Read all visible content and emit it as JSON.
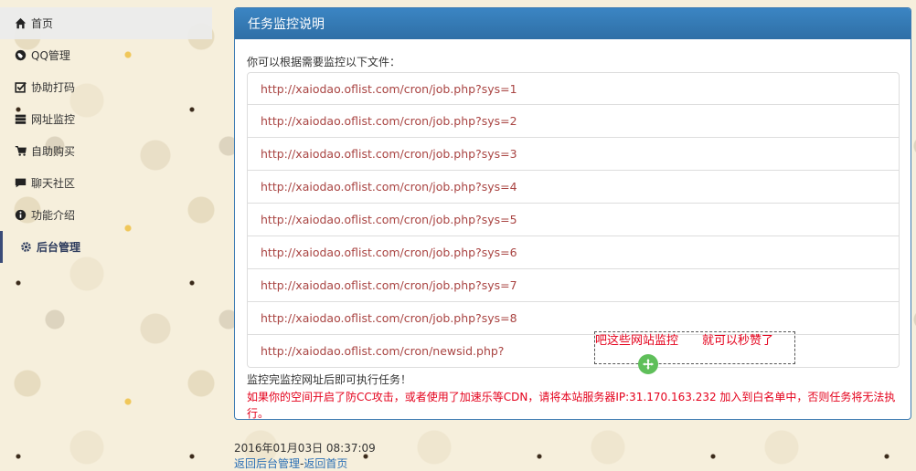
{
  "sidebar": {
    "items": [
      {
        "label": "首页",
        "icon": "home-icon"
      },
      {
        "label": "QQ管理",
        "icon": "globe-icon"
      },
      {
        "label": "协助打码",
        "icon": "check-square-icon"
      },
      {
        "label": "网址监控",
        "icon": "server-icon"
      },
      {
        "label": "自助购买",
        "icon": "cart-icon"
      },
      {
        "label": "聊天社区",
        "icon": "comment-icon"
      },
      {
        "label": "功能介绍",
        "icon": "info-circle-icon"
      },
      {
        "label": "后台管理",
        "icon": "cog-icon"
      }
    ]
  },
  "panel": {
    "title": "任务监控说明",
    "intro": "你可以根据需要监控以下文件：",
    "urls": [
      "http://xaiodao.oflist.com/cron/job.php?sys=1",
      "http://xaiodao.oflist.com/cron/job.php?sys=2",
      "http://xaiodao.oflist.com/cron/job.php?sys=3",
      "http://xaiodao.oflist.com/cron/job.php?sys=4",
      "http://xaiodao.oflist.com/cron/job.php?sys=5",
      "http://xaiodao.oflist.com/cron/job.php?sys=6",
      "http://xaiodao.oflist.com/cron/job.php?sys=7",
      "http://xaiodao.oflist.com/cron/job.php?sys=8",
      "http://xaiodao.oflist.com/cron/newsid.php?"
    ],
    "note": "监控完监控网址后即可执行任务！",
    "warning": "如果你的空间开启了防CC攻击，或者使用了加速乐等CDN，请将本站服务器IP:31.170.163.232 加入到白名单中，否则任务将无法执行。"
  },
  "annotation": {
    "text": "吧这些网站监控　　就可以秒赞了"
  },
  "footer": {
    "datetime": "2016年01月03日 08:37:09",
    "link_admin": "返回后台管理",
    "separator": "-",
    "link_home": "返回首页"
  },
  "colors": {
    "panel_header": "#337ab7",
    "link_red": "#a94442",
    "warning_red": "#e4001b",
    "footer_link": "#2a6fb5"
  }
}
